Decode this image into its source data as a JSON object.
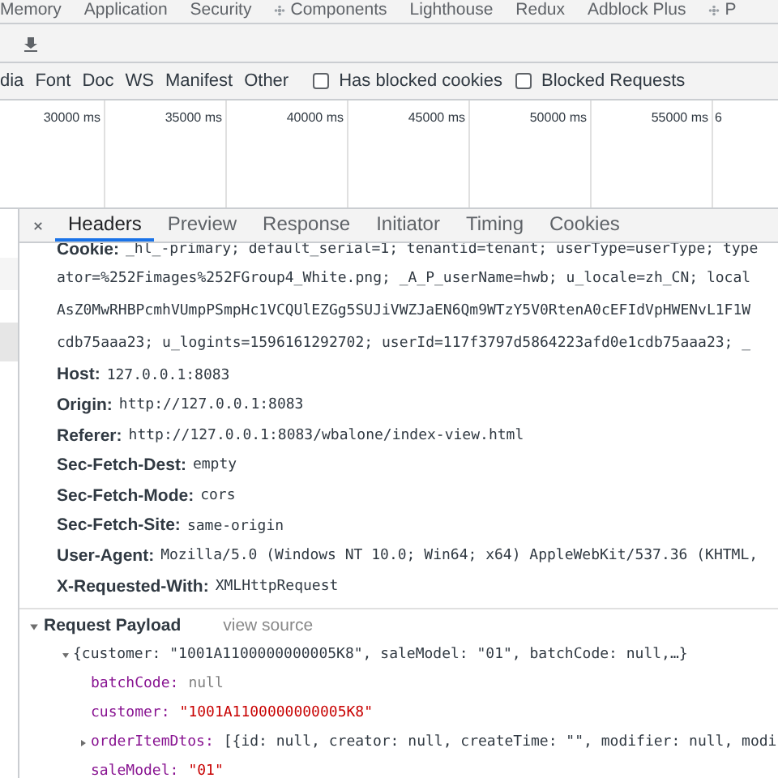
{
  "panel_tabs": [
    {
      "label": "Memory",
      "icon": false
    },
    {
      "label": "Application",
      "icon": false
    },
    {
      "label": "Security",
      "icon": false
    },
    {
      "label": "Components",
      "icon": true
    },
    {
      "label": "Lighthouse",
      "icon": false
    },
    {
      "label": "Redux",
      "icon": false
    },
    {
      "label": "Adblock Plus",
      "icon": false
    },
    {
      "label": "P",
      "icon": true
    }
  ],
  "filter_types": [
    "dia",
    "Font",
    "Doc",
    "WS",
    "Manifest",
    "Other"
  ],
  "filter_checks": [
    {
      "label": "Has blocked cookies",
      "checked": false
    },
    {
      "label": "Blocked Requests",
      "checked": false
    }
  ],
  "timeline_ticks": [
    "30000 ms",
    "35000 ms",
    "40000 ms",
    "45000 ms",
    "50000 ms",
    "55000 ms",
    "6"
  ],
  "detail_tabs": [
    {
      "label": "Headers",
      "selected": true
    },
    {
      "label": "Preview",
      "selected": false
    },
    {
      "label": "Response",
      "selected": false
    },
    {
      "label": "Initiator",
      "selected": false
    },
    {
      "label": "Timing",
      "selected": false
    },
    {
      "label": "Cookies",
      "selected": false
    }
  ],
  "headers": [
    {
      "name": "Cookie:",
      "value": "_hl_-primary; default_serial=1; tenantid=tenant; userType=userType; type"
    },
    {
      "value": "ator=%252Fimages%252FGroup4_White.png; _A_P_userName=hwb; u_locale=zh_CN; local"
    },
    {
      "value": "AsZ0MwRHBPcmhVUmpPSmpHc1VCQUlEZGg5SUJiVWZJaEN6Qm9WTzY5V0RtenA0cEFIdVpHWENvL1F1W"
    },
    {
      "value": "cdb75aaa23; u_logints=1596161292702; userId=117f3797d5864223afd0e1cdb75aaa23; _"
    },
    {
      "name": "Host:",
      "value": "127.0.0.1:8083"
    },
    {
      "name": "Origin:",
      "value": "http://127.0.0.1:8083"
    },
    {
      "name": "Referer:",
      "value": "http://127.0.0.1:8083/wbalone/index-view.html"
    },
    {
      "name": "Sec-Fetch-Dest:",
      "value": "empty"
    },
    {
      "name": "Sec-Fetch-Mode:",
      "value": "cors"
    },
    {
      "name": "Sec-Fetch-Site:",
      "value": "same-origin"
    },
    {
      "name": "User-Agent:",
      "value": "Mozilla/5.0 (Windows NT 10.0; Win64; x64) AppleWebKit/537.36 (KHTML,"
    },
    {
      "name": "X-Requested-With:",
      "value": "XMLHttpRequest"
    }
  ],
  "payload": {
    "title": "Request Payload",
    "expanded": true,
    "link": "view source",
    "summary": "{customer: \"1001A1100000000005K8\", saleModel: \"01\", batchCode: null,…}",
    "summary_expanded": true,
    "fields": [
      {
        "key": "batchCode:",
        "value": "null",
        "kind": "null"
      },
      {
        "key": "customer:",
        "value": "\"1001A1100000000005K8\"",
        "kind": "string"
      },
      {
        "key": "orderItemDtos:",
        "value": "[{id: null, creator: null, createTime: \"\", modifier: null, modi",
        "kind": "object",
        "expanded": false
      },
      {
        "key": "saleModel:",
        "value": "\"01\"",
        "kind": "string"
      }
    ]
  }
}
